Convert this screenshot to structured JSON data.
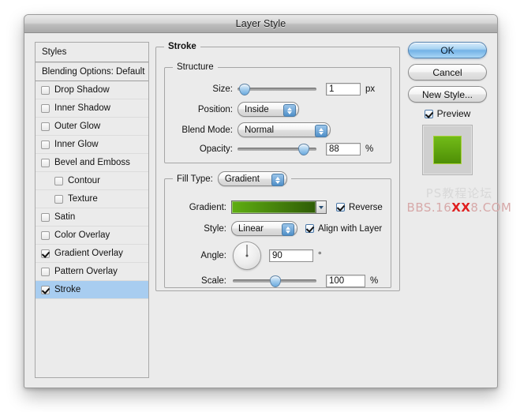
{
  "window": {
    "title": "Layer Style"
  },
  "styles_panel": {
    "header": "Styles",
    "blending_options": "Blending Options: Default",
    "items": [
      {
        "label": "Drop Shadow",
        "checked": false,
        "indent": false,
        "selected": false
      },
      {
        "label": "Inner Shadow",
        "checked": false,
        "indent": false,
        "selected": false
      },
      {
        "label": "Outer Glow",
        "checked": false,
        "indent": false,
        "selected": false
      },
      {
        "label": "Inner Glow",
        "checked": false,
        "indent": false,
        "selected": false
      },
      {
        "label": "Bevel and Emboss",
        "checked": false,
        "indent": false,
        "selected": false
      },
      {
        "label": "Contour",
        "checked": false,
        "indent": true,
        "selected": false
      },
      {
        "label": "Texture",
        "checked": false,
        "indent": true,
        "selected": false
      },
      {
        "label": "Satin",
        "checked": false,
        "indent": false,
        "selected": false
      },
      {
        "label": "Color Overlay",
        "checked": false,
        "indent": false,
        "selected": false
      },
      {
        "label": "Gradient Overlay",
        "checked": true,
        "indent": false,
        "selected": false
      },
      {
        "label": "Pattern Overlay",
        "checked": false,
        "indent": false,
        "selected": false
      },
      {
        "label": "Stroke",
        "checked": true,
        "indent": false,
        "selected": true
      }
    ]
  },
  "stroke": {
    "group_title": "Stroke",
    "structure": {
      "group_title": "Structure",
      "size": {
        "label": "Size:",
        "value": "1",
        "unit": "px",
        "slider_percent": 2
      },
      "position": {
        "label": "Position:",
        "value": "Inside"
      },
      "blend_mode": {
        "label": "Blend Mode:",
        "value": "Normal"
      },
      "opacity": {
        "label": "Opacity:",
        "value": "88",
        "unit": "%",
        "slider_percent": 88
      }
    },
    "fill": {
      "fill_type_label": "Fill Type:",
      "fill_type_value": "Gradient",
      "gradient": {
        "label": "Gradient:",
        "start_color": "#5fae12",
        "end_color": "#2f5c06",
        "reverse_label": "Reverse",
        "reverse_checked": true
      },
      "style": {
        "label": "Style:",
        "value": "Linear",
        "align_label": "Align with Layer",
        "align_checked": true
      },
      "angle": {
        "label": "Angle:",
        "value": "90",
        "unit": "°"
      },
      "scale": {
        "label": "Scale:",
        "value": "100",
        "unit": "%",
        "slider_percent": 50
      }
    }
  },
  "actions": {
    "ok": "OK",
    "cancel": "Cancel",
    "new_style": "New Style...",
    "preview_label": "Preview",
    "preview_checked": true,
    "thumbnail": {
      "fill_top": "#72bb18",
      "fill_bottom": "#4e8f06",
      "stroke_color": "#a8d13a"
    }
  },
  "watermark": {
    "line1": "PS教程论坛",
    "line2_pre": "BBS.16",
    "line2_red": "XX",
    "line2_post": "8.COM"
  }
}
